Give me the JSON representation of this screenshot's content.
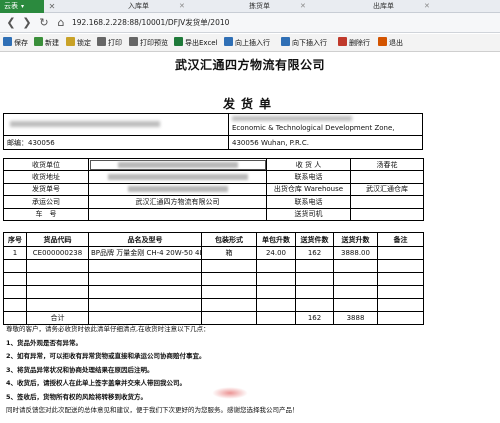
{
  "browser": {
    "active_tab": "云表",
    "tabs": [
      "入库单",
      "拣货单",
      "出库单"
    ],
    "url": "192.168.2.228:88/10001/DFJV发货单/2010"
  },
  "toolbar": {
    "items": [
      {
        "label": "保存",
        "icon": "save-icon",
        "color": "#2f6fb5"
      },
      {
        "label": "新建",
        "icon": "new-icon",
        "color": "#3a8f3a"
      },
      {
        "label": "锁定",
        "icon": "lock-icon",
        "color": "#c9a227"
      },
      {
        "label": "打印",
        "icon": "print-icon",
        "color": "#555555"
      },
      {
        "label": "打印预览",
        "icon": "print-preview-icon",
        "color": "#555555"
      },
      {
        "label": "导出Excel",
        "icon": "excel-icon",
        "color": "#1f7a3a"
      },
      {
        "label": "向上插入行",
        "icon": "insert-row-above-icon",
        "color": "#2f6fb5"
      },
      {
        "label": "向下插入行",
        "icon": "insert-row-below-icon",
        "color": "#2f6fb5"
      },
      {
        "label": "删除行",
        "icon": "delete-row-icon",
        "color": "#c0392b"
      },
      {
        "label": "退出",
        "icon": "exit-icon",
        "color": "#d35400"
      }
    ]
  },
  "document": {
    "company": "武汉汇通四方物流有限公司",
    "title": "发货单",
    "address": {
      "line1_right": "Economic & Technological Development Zone,",
      "postcode_left": "邮编：430056",
      "line2_right": "430056 Wuhan, P.R.C."
    },
    "info": {
      "receiver_unit_label": "收货单位",
      "receiver_label": "收 货 人",
      "receiver_value": "汤春花",
      "receiver_addr_label": "收货地址",
      "phone_label": "联系电话",
      "ship_no_label": "发货单号",
      "warehouse_label": "出货仓库 Warehouse",
      "warehouse_value": "武汉汇通仓库",
      "carrier_label": "承运公司",
      "carrier_value": "武汉汇通四方物流有限公司",
      "carrier_phone_label": "联系电话",
      "vehicle_label": "车　号",
      "driver_label": "送货司机"
    },
    "items": {
      "headers": [
        "序号",
        "货品代码",
        "品名及型号",
        "包装形式",
        "单包升数",
        "送货件数",
        "送货升数",
        "备注"
      ],
      "rows": [
        [
          "1",
          "CE000000238",
          "BP品牌 万量金刚 CH-4 20W-50 4L",
          "箱",
          "24.00",
          "162",
          "3888.00",
          ""
        ]
      ],
      "total_label": "合计",
      "total_qty": "162",
      "total_liters": "3888"
    },
    "notes": {
      "intro": "尊敬的客户，请务必收货时依此清单仔细清点,在收货时注意以下几点：",
      "items": [
        "1、货品外观是否有异常。",
        "2、如有异常，可以拒收有异常货物或直接和承运公司协商赔付事宜。",
        "3、将货品异常状况和协商处理结果在原因后注明。",
        "4、收货后，请授权人在此单上签字盖章并交来人带回我公司。",
        "5、签收后，货物所有权的风险将转移到收货方。"
      ],
      "footer": "同时请反馈您对此次配送的总体意见和建议，便于我们下次更好的为您服务。感谢您选择我公司产品！"
    }
  }
}
